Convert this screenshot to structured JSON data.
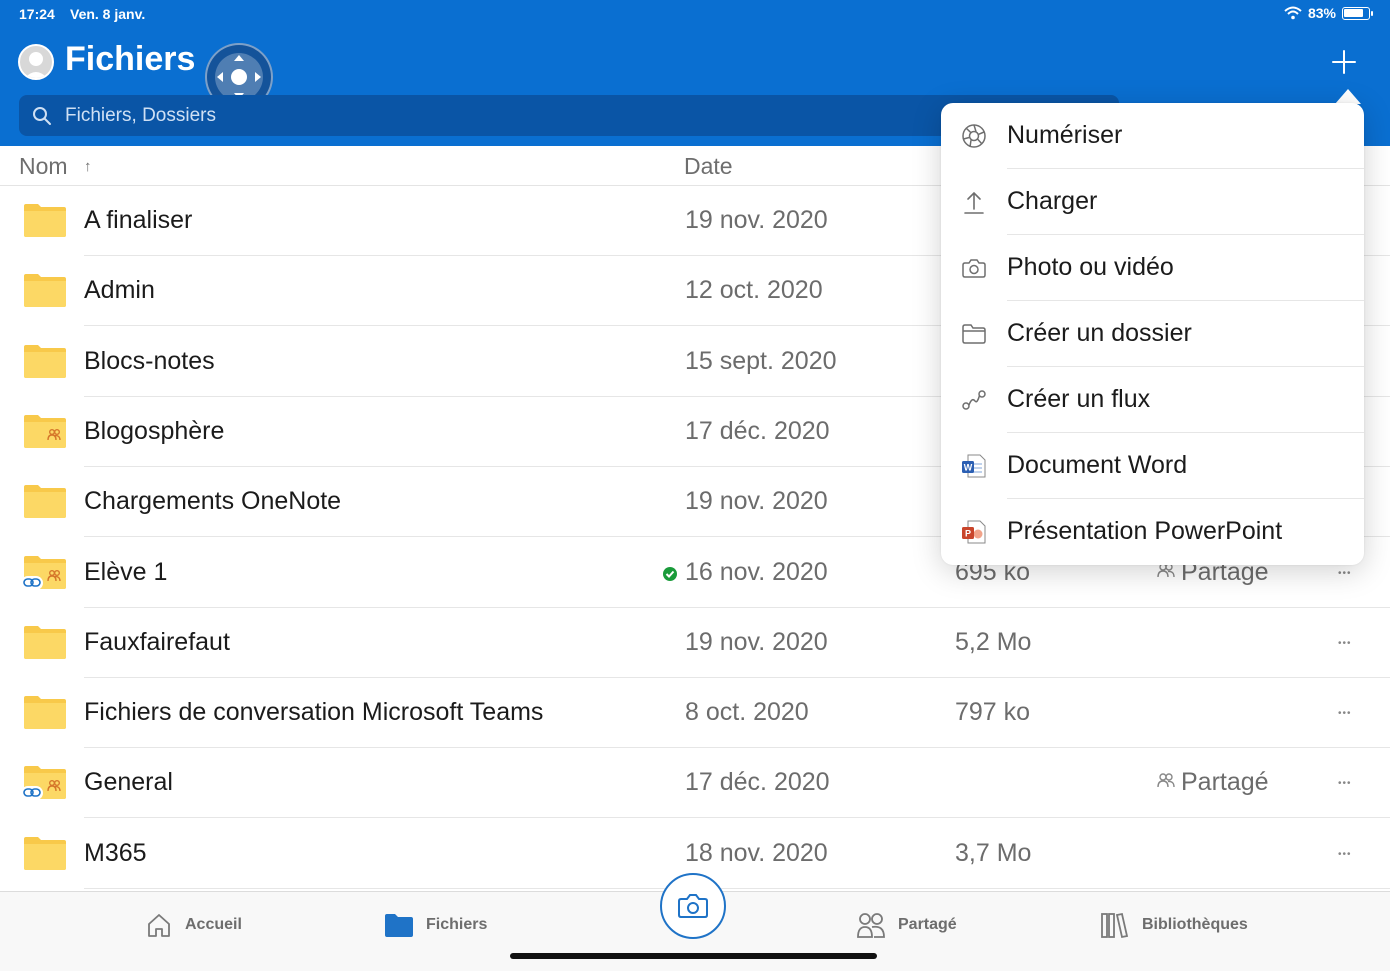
{
  "status": {
    "time": "17:24",
    "date": "Ven. 8 janv.",
    "battery": "83%",
    "battery_level": 0.83
  },
  "header": {
    "title": "Fichiers",
    "search_placeholder": "Fichiers, Dossiers"
  },
  "columns": {
    "name": "Nom",
    "date": "Date"
  },
  "rows": [
    {
      "name": "A finaliser",
      "date": "19 nov. 2020",
      "size": "",
      "share": "",
      "icon": "folder"
    },
    {
      "name": "Admin",
      "date": "12 oct. 2020",
      "size": "",
      "share": "",
      "icon": "folder"
    },
    {
      "name": "Blocs-notes",
      "date": "15 sept. 2020",
      "size": "",
      "share": "",
      "icon": "folder"
    },
    {
      "name": "Blogosphère",
      "date": "17 déc. 2020",
      "size": "",
      "share": "",
      "icon": "shared-folder"
    },
    {
      "name": "Chargements OneNote",
      "date": "19 nov. 2020",
      "size": "",
      "share": "",
      "icon": "folder"
    },
    {
      "name": "Elève 1",
      "date": "16 nov. 2020",
      "size": "695 ko",
      "share": "Partagé",
      "icon": "shared-linked-folder"
    },
    {
      "name": "Fauxfairefaut",
      "date": "19 nov. 2020",
      "size": "5,2 Mo",
      "share": "",
      "icon": "folder"
    },
    {
      "name": "Fichiers de conversation Microsoft Teams",
      "date": "8 oct. 2020",
      "size": "797 ko",
      "share": "",
      "icon": "folder"
    },
    {
      "name": "General",
      "date": "17 déc. 2020",
      "size": "",
      "share": "Partagé",
      "icon": "shared-linked-folder"
    },
    {
      "name": "M365",
      "date": "18 nov. 2020",
      "size": "3,7 Mo",
      "share": "",
      "icon": "folder"
    }
  ],
  "menu": {
    "items": [
      {
        "label": "Numériser",
        "icon": "aperture-icon"
      },
      {
        "label": "Charger",
        "icon": "upload-icon"
      },
      {
        "label": "Photo ou vidéo",
        "icon": "camera-icon"
      },
      {
        "label": "Créer un dossier",
        "icon": "folder-outline-icon"
      },
      {
        "label": "Créer un flux",
        "icon": "flow-icon"
      },
      {
        "label": "Document Word",
        "icon": "word-icon"
      },
      {
        "label": "Présentation PowerPoint",
        "icon": "powerpoint-icon"
      }
    ]
  },
  "nav": {
    "home": "Accueil",
    "files": "Fichiers",
    "shared": "Partagé",
    "libraries": "Bibliothèques"
  },
  "colors": {
    "header": "#0a6fd1",
    "search": "#0a55a6",
    "folder": "#f8c94a",
    "accent": "#1f73c7",
    "sync_ok": "#1a9b3a"
  }
}
